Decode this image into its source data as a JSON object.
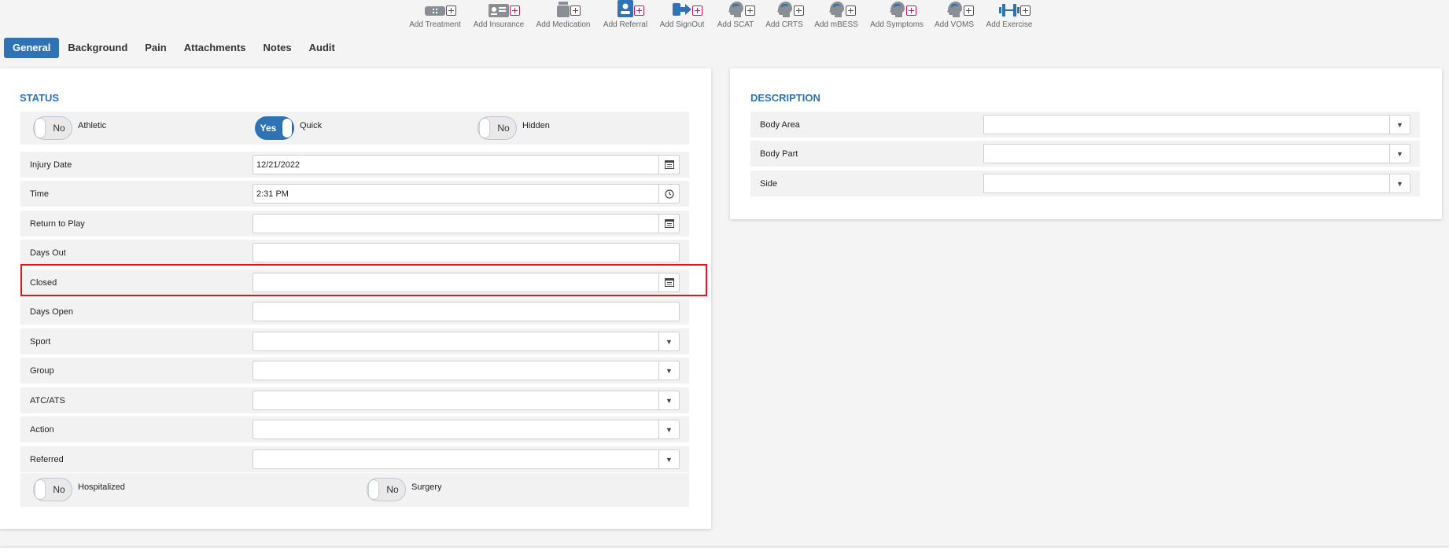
{
  "toolbar": [
    {
      "label": "Add Treatment",
      "icon": "treatment-icon"
    },
    {
      "label": "Add Insurance",
      "icon": "insurance-card-icon"
    },
    {
      "label": "Add Medication",
      "icon": "medication-icon"
    },
    {
      "label": "Add Referral",
      "icon": "referral-icon"
    },
    {
      "label": "Add SignOut",
      "icon": "signout-icon"
    },
    {
      "label": "Add SCAT",
      "icon": "head-icon"
    },
    {
      "label": "Add CRTS",
      "icon": "head-icon"
    },
    {
      "label": "Add mBESS",
      "icon": "head-icon"
    },
    {
      "label": "Add Symptoms",
      "icon": "head-icon"
    },
    {
      "label": "Add VOMS",
      "icon": "head-icon"
    },
    {
      "label": "Add Exercise",
      "icon": "dumbbell-icon"
    }
  ],
  "tabs": [
    "General",
    "Background",
    "Pain",
    "Attachments",
    "Notes",
    "Audit"
  ],
  "active_tab": "General",
  "status": {
    "title": "STATUS",
    "toggles": [
      {
        "value": "No",
        "label": "Athletic",
        "state": false
      },
      {
        "value": "Yes",
        "label": "Quick",
        "state": true
      },
      {
        "value": "No",
        "label": "Hidden",
        "state": false
      }
    ],
    "fields": [
      {
        "label": "Injury Date",
        "value": "12/21/2022",
        "kind": "date"
      },
      {
        "label": "Time",
        "value": "2:31 PM",
        "kind": "time"
      },
      {
        "label": "Return to Play",
        "value": "",
        "kind": "date"
      },
      {
        "label": "Days Out",
        "value": "",
        "kind": "text"
      },
      {
        "label": "Closed",
        "value": "",
        "kind": "date"
      },
      {
        "label": "Days Open",
        "value": "",
        "kind": "text"
      },
      {
        "label": "Sport",
        "value": "",
        "kind": "select"
      },
      {
        "label": "Group",
        "value": "",
        "kind": "select"
      },
      {
        "label": "ATC/ATS",
        "value": "",
        "kind": "select"
      },
      {
        "label": "Action",
        "value": "",
        "kind": "select"
      },
      {
        "label": "Referred",
        "value": "",
        "kind": "select"
      }
    ],
    "bottom_toggles": [
      {
        "value": "No",
        "label": "Hospitalized",
        "state": false
      },
      {
        "value": "No",
        "label": "Surgery",
        "state": false
      }
    ]
  },
  "description": {
    "title": "DESCRIPTION",
    "fields": [
      {
        "label": "Body Area",
        "value": ""
      },
      {
        "label": "Body Part",
        "value": ""
      },
      {
        "label": "Side",
        "value": ""
      }
    ]
  },
  "colors": {
    "accent": "#2f73b5",
    "highlight": "#e01818",
    "plus": "#c2185b"
  }
}
